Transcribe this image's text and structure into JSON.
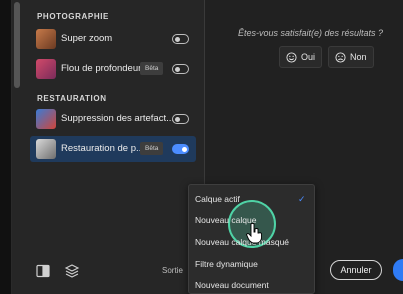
{
  "panel": {
    "photography_title": "PHOTOGRAPHIE",
    "restoration_title": "RESTAURATION",
    "beta_label": "Bêta",
    "items": [
      {
        "label": "Super zoom",
        "enabled": false
      },
      {
        "label": "Flou de profondeur",
        "beta": true,
        "enabled": false
      },
      {
        "label": "Suppression des artefact...",
        "enabled": false
      },
      {
        "label": "Restauration de p...",
        "beta": true,
        "enabled": true
      }
    ]
  },
  "feedback": {
    "question": "Êtes-vous satisfait(e) des résultats ?",
    "yes": "Oui",
    "no": "Non"
  },
  "bottom": {
    "output_label": "Sortie",
    "cancel": "Annuler"
  },
  "output_menu": {
    "options": [
      "Calque actif",
      "Nouveau calque",
      "Nouveau calque masqué",
      "Filtre dynamique",
      "Nouveau document"
    ],
    "selected": "Calque actif",
    "hovered": "Nouveau calque"
  },
  "colors": {
    "accent": "#4c8dff",
    "selected_row": "#1f3a5c",
    "cursor_highlight": "#4fd3a6"
  },
  "icons": [
    "smile-icon",
    "frown-icon",
    "compare-icon",
    "layers-icon",
    "checkmark-icon",
    "hand-cursor-icon"
  ]
}
